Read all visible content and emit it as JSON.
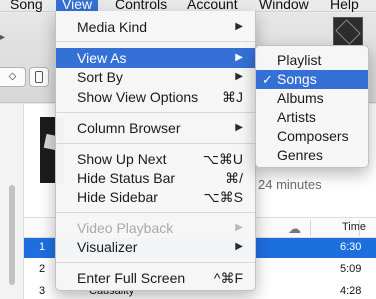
{
  "menubar": {
    "items": [
      {
        "label": "Song"
      },
      {
        "label": "View"
      },
      {
        "label": "Controls"
      },
      {
        "label": "Account"
      },
      {
        "label": "Window"
      },
      {
        "label": "Help"
      }
    ]
  },
  "view_menu": {
    "items": [
      {
        "label": "Media Kind",
        "shortcut": "",
        "arrow": "▶"
      },
      {
        "label": "View As",
        "shortcut": "",
        "arrow": "▶"
      },
      {
        "label": "Sort By",
        "shortcut": "",
        "arrow": "▶"
      },
      {
        "label": "Show View Options",
        "shortcut": "⌘J"
      },
      {
        "label": "Column Browser",
        "arrow": "▶"
      },
      {
        "label": "Show Up Next",
        "shortcut": "⌥⌘U"
      },
      {
        "label": "Hide Status Bar",
        "shortcut": "⌘/"
      },
      {
        "label": "Hide Sidebar",
        "shortcut": "⌥⌘S"
      },
      {
        "label": "Video Playback",
        "arrow": "▶"
      },
      {
        "label": "Visualizer",
        "arrow": "▶"
      },
      {
        "label": "Enter Full Screen",
        "shortcut": "^⌘F"
      }
    ]
  },
  "view_as_submenu": {
    "checkmark": "✓",
    "items": [
      {
        "label": "Playlist"
      },
      {
        "label": "Songs"
      },
      {
        "label": "Albums"
      },
      {
        "label": "Artists"
      },
      {
        "label": "Composers"
      },
      {
        "label": "Genres"
      }
    ]
  },
  "toolbar": {
    "left_glyph": "▸",
    "segment_label": "◇"
  },
  "playlist_info": {
    "duration_text": "24 minutes"
  },
  "table": {
    "time_header": "Time",
    "cloud_icon": "☁",
    "rows": [
      {
        "num": "1",
        "title": "",
        "time": "6:30"
      },
      {
        "num": "2",
        "title": "",
        "time": "5:09"
      },
      {
        "num": "3",
        "title": "Causality",
        "time": "4:28"
      }
    ]
  },
  "colors": {
    "highlight": "#3470d6",
    "selected_row": "#1d6fe0"
  }
}
